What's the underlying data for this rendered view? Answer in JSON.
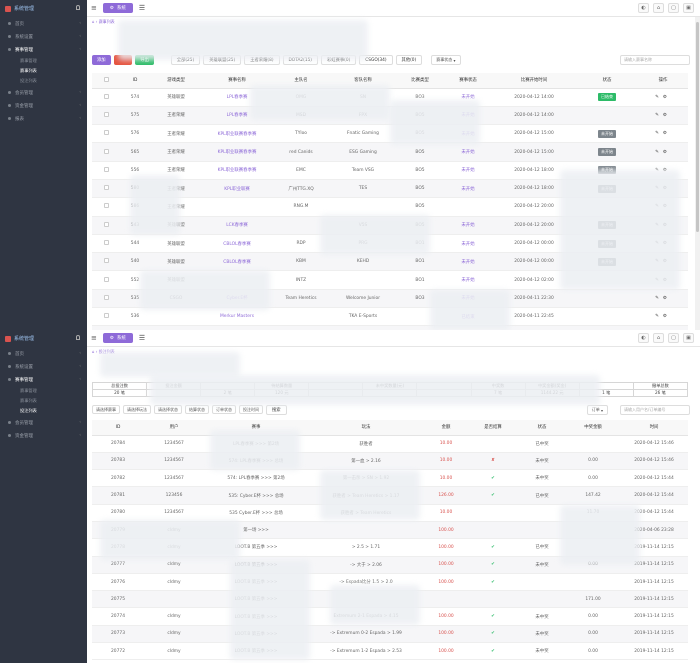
{
  "app": {
    "logo_text": "系统管理"
  },
  "panel1": {
    "nav": [
      {
        "label": "首页",
        "active": false
      },
      {
        "label": "系统设置",
        "active": false
      },
      {
        "label": "赛事管理",
        "active": true
      },
      {
        "sub": true,
        "label": "赛事管理",
        "active": false
      },
      {
        "sub": true,
        "label": "赛事列表",
        "active": true
      },
      {
        "sub": true,
        "label": "投注列表",
        "active": false
      },
      {
        "label": "会员管理",
        "active": false
      },
      {
        "label": "资金管理",
        "active": false
      },
      {
        "label": "报表",
        "active": false
      }
    ],
    "tab": "系统",
    "breadcrumb": "赛事列表",
    "toolbar": {
      "add": "添加",
      "delete": "删除",
      "green": "导出",
      "filters": [
        "全部(25)",
        "英雄联盟(25)",
        "王者荣耀(8)",
        "DOTA2(15)",
        "彩虹赛事(0)",
        "CSGO(34)",
        "其他(0)"
      ],
      "status": "赛事状态",
      "search_placeholder": "请输入赛事名称"
    },
    "headers": [
      "",
      "ID",
      "游戏类型",
      "赛事名称",
      "主队名",
      "客队名称",
      "比赛类型",
      "赛事状态",
      "比赛开始时间",
      "状态",
      "操作"
    ],
    "rows": [
      {
        "id": "574",
        "game": "英雄联盟",
        "name": "LPL春季赛",
        "home": "OMG",
        "away": "SN",
        "type": "BO3",
        "status": "未开始",
        "time": "2020-04-12 14:00",
        "badge": "已结束",
        "badge_color": "green"
      },
      {
        "id": "575",
        "game": "王者荣耀",
        "name": "LPL春季赛",
        "home": "MSD",
        "away": "FPX",
        "type": "BO5",
        "status": "未开始",
        "time": "2020-04-12 14:00",
        "badge": "",
        "badge_color": ""
      },
      {
        "id": "576",
        "game": "王者荣耀",
        "name": "KPL职业联赛春季赛",
        "home": "TYloo",
        "away": "Fnatic Gaming",
        "type": "BO5",
        "status": "未开始",
        "time": "2020-04-12 15:00",
        "badge": "未开始",
        "badge_color": "gray"
      },
      {
        "id": "565",
        "game": "王者荣耀",
        "name": "KPL职业联赛春季赛",
        "home": "red Canids",
        "away": "ESG Gaming",
        "type": "BO5",
        "status": "未开始",
        "time": "2020-04-12 15:00",
        "badge": "未开始",
        "badge_color": "gray"
      },
      {
        "id": "556",
        "game": "王者荣耀",
        "name": "KPL职业联赛春季赛",
        "home": "EMC",
        "away": "Team VSG",
        "type": "BO5",
        "status": "未开始",
        "time": "2020-04-12 18:00",
        "badge": "未开始",
        "badge_color": "gray"
      },
      {
        "id": "580",
        "game": "王者荣耀",
        "name": "KPL职业联赛",
        "home": "广州TTG.XQ",
        "away": "TES",
        "type": "BO5",
        "status": "未开始",
        "time": "2020-04-12 18:00",
        "badge": "未开始",
        "badge_color": "gray"
      },
      {
        "id": "586",
        "game": "王者荣耀",
        "name": "",
        "home": "RNG.M",
        "away": "",
        "type": "BO5",
        "status": "",
        "time": "2020-04-12 20:00",
        "badge": "",
        "badge_color": ""
      },
      {
        "id": "543",
        "game": "英雄联盟",
        "name": "LCK春季赛",
        "home": "",
        "away": "V5S",
        "type": "BO5",
        "status": "未开始",
        "time": "2020-04-12 20:00",
        "badge": "未开始",
        "badge_color": "gray"
      },
      {
        "id": "544",
        "game": "英雄联盟",
        "name": "CBLOL春季赛",
        "home": "RDP",
        "away": "PRG",
        "type": "BO1",
        "status": "未开始",
        "time": "2020-04-12 00:00",
        "badge": "未开始",
        "badge_color": "gray"
      },
      {
        "id": "540",
        "game": "英雄联盟",
        "name": "CBLOL春季赛",
        "home": "KBM",
        "away": "KEHD",
        "type": "BO1",
        "status": "未开始",
        "time": "2020-04-12 00:00",
        "badge": "未开始",
        "badge_color": "gray"
      },
      {
        "id": "552",
        "game": "英雄联盟",
        "name": "",
        "home": "INTZ",
        "away": "",
        "type": "BO1",
        "status": "未开始",
        "time": "2020-04-12 02:00",
        "badge": "",
        "badge_color": ""
      },
      {
        "id": "535",
        "game": "CSGO",
        "name": "Cyber.E杯",
        "home": "Team Heretics",
        "away": "Welcome Junior",
        "type": "BO3",
        "status": "未开始",
        "time": "2020-04-11 22:30",
        "badge": "",
        "badge_color": ""
      },
      {
        "id": "536",
        "game": "",
        "name": "Merkur Masters",
        "home": "",
        "away": "TKA E-Sports",
        "type": "",
        "status": "已结束",
        "time": "2020-04-11 22:45",
        "badge": "",
        "badge_color": ""
      },
      {
        "id": "537",
        "game": "CSGO",
        "name": "Merkur Masters",
        "home": "plan B eSports",
        "away": "touch the crown",
        "type": "BO3",
        "status": "已结束",
        "time": "2020-04-11 22:45",
        "badge": "已结束",
        "badge_color": "green"
      }
    ]
  },
  "panel2": {
    "nav": [
      {
        "label": "首页",
        "active": false
      },
      {
        "label": "系统设置",
        "active": false
      },
      {
        "label": "赛事管理",
        "active": true
      },
      {
        "sub": true,
        "label": "赛事管理",
        "active": false
      },
      {
        "sub": true,
        "label": "赛事列表",
        "active": false
      },
      {
        "sub": true,
        "label": "投注列表",
        "active": true
      },
      {
        "label": "会员管理",
        "active": false
      },
      {
        "label": "资金管理",
        "active": false
      }
    ],
    "tab": "系统",
    "breadcrumb": "投注列表",
    "summary": {
      "row1": [
        "总投注数",
        "投注金额",
        "",
        "待结算数量",
        "",
        "未中奖数量(元)",
        "",
        "中奖数",
        "中奖金额(奖金)",
        "",
        "撤单总数"
      ],
      "row2": [
        "20 笔",
        "",
        "2 笔",
        "120 元",
        "",
        "",
        "",
        "7 笔",
        "1144.22 元",
        "1 笔",
        "26 笔"
      ]
    },
    "filters": [
      "请选择赛事",
      "请选择玩法",
      "请选择状态",
      "结算状态",
      "订单状态",
      "投注时间",
      "搜索"
    ],
    "filter_right": "订单",
    "filter_placeholder": "请输入用户名/订单编号",
    "headers": [
      "ID",
      "用户",
      "赛事",
      "玩法",
      "金额",
      "是否结算",
      "状态",
      "中奖金额",
      "时间"
    ],
    "rows": [
      {
        "id": "20784",
        "user": "1234567",
        "event": "LPL春季赛 >>> 第2场",
        "play": "获胜者",
        "amount": "10.00",
        "settled": "",
        "status": "已中奖",
        "win": "",
        "time": "2020-04-12 15:46"
      },
      {
        "id": "20783",
        "user": "1234567",
        "event": "574: LPL春季赛 >>> 总场",
        "play": "第一血 > 2.16",
        "amount": "10.00",
        "settled": "x",
        "status": "未中奖",
        "win": "0.00",
        "time": "2020-04-12 15:46"
      },
      {
        "id": "20782",
        "user": "1234567",
        "event": "574: LPL春季赛 >>> 第2场",
        "play": "第一击杀 > SN > 1.92",
        "amount": "10.00",
        "settled": "v",
        "status": "未中奖",
        "win": "0.00",
        "time": "2020-04-12 15:44"
      },
      {
        "id": "20781",
        "user": "123456",
        "event": "535: Cyber.E杯 >>> 总场",
        "play": "获胜者 > Team Heretics > 1.17",
        "amount": "126.00",
        "settled": "v",
        "status": "已中奖",
        "win": "147.42",
        "time": "2020-04-12 15:44"
      },
      {
        "id": "20780",
        "user": "1234567",
        "event": "535 Cyber.E杯 >>> 总场",
        "play": "获胜者 > Team Heretics",
        "amount": "10.00",
        "settled": "",
        "status": "",
        "win": "11.70",
        "time": "2020-04-12 15:44"
      },
      {
        "id": "20779",
        "user": "cldmy",
        "event": "第一场 >>>",
        "play": "",
        "amount": "100.00",
        "settled": "",
        "status": "",
        "win": "",
        "time": "2020-04-06 23:28"
      },
      {
        "id": "20778",
        "user": "cldmy",
        "event": "LOOT.B 第五季 >>>",
        "play": "> 2.5 > 1.71",
        "amount": "100.00",
        "settled": "v",
        "status": "已中奖",
        "win": "",
        "time": "2019-11-14 12:15"
      },
      {
        "id": "20777",
        "user": "cldmy",
        "event": "LOOT.B 第五季 >>>",
        "play": "-> 大于 > 2.06",
        "amount": "100.00",
        "settled": "v",
        "status": "未中奖",
        "win": "0.00",
        "time": "2019-11-14 12:15"
      },
      {
        "id": "20776",
        "user": "cldmy",
        "event": "LOOT.B 第五季 >>>",
        "play": "-> Espada比分 1.5 > 2.0",
        "amount": "100.00",
        "settled": "v",
        "status": "",
        "win": "",
        "time": "2019-11-14 12:15"
      },
      {
        "id": "20775",
        "user": "",
        "event": "LOOT.B 第五季 >>>",
        "play": "",
        "amount": "",
        "settled": "",
        "status": "",
        "win": "171.00",
        "time": "2019-11-14 12:15"
      },
      {
        "id": "20774",
        "user": "cldmy",
        "event": "LOOT.B 第五季 >>>",
        "play": "Extremum 2-1 Espada > 4.15",
        "amount": "100.00",
        "settled": "v",
        "status": "未中奖",
        "win": "0.00",
        "time": "2019-11-14 12:15"
      },
      {
        "id": "20773",
        "user": "cldmy",
        "event": "LOOT.B 第五季 >>>",
        "play": "-> Extremum 0-2 Espada > 1.99",
        "amount": "100.00",
        "settled": "v",
        "status": "未中奖",
        "win": "0.00",
        "time": "2019-11-14 12:15"
      },
      {
        "id": "20772",
        "user": "cldmy",
        "event": "LOOT.B 第五季 >>>",
        "play": "-> Extremum 1-2 Espada > 2.53",
        "amount": "100.00",
        "settled": "v",
        "status": "未中奖",
        "win": "0.00",
        "time": "2019-11-14 12:15"
      }
    ]
  }
}
